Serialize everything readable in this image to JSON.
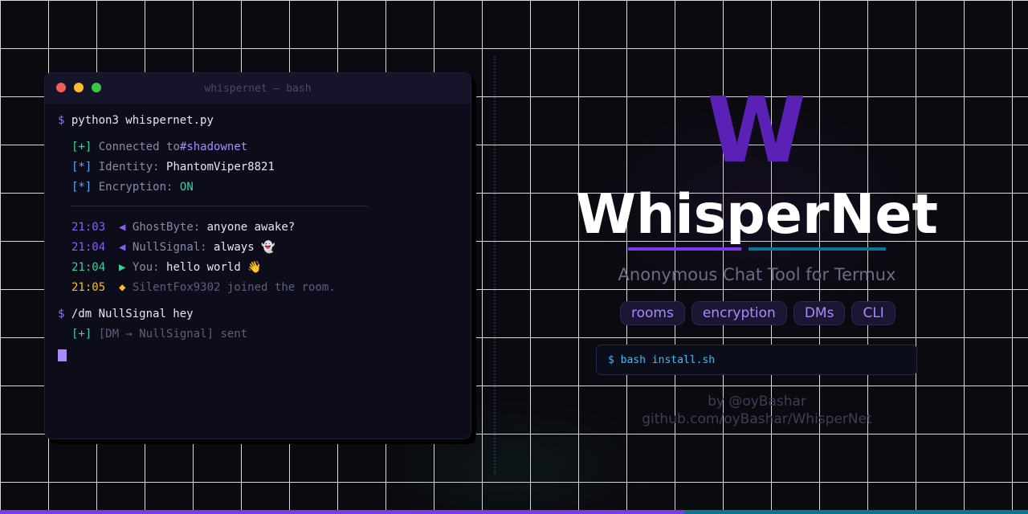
{
  "terminal": {
    "title": "whispernet — bash",
    "prompt": "$",
    "command1": "python3 whispernet.py",
    "status": [
      {
        "bracket": "[+]",
        "label": "Connected to",
        "value": "#shadownet"
      },
      {
        "bracket": "[*]",
        "label": "Identity:",
        "value": "PhantomViper8821"
      },
      {
        "bracket": "[*]",
        "label": "Encryption:",
        "value": "ON"
      }
    ],
    "messages": [
      {
        "time": "21:03",
        "marker": "◀",
        "user": "GhostByte:",
        "text": "anyone awake?"
      },
      {
        "time": "21:04",
        "marker": "◀",
        "user": "NullSignal:",
        "text": "always 👻"
      },
      {
        "time": "21:04",
        "marker": "▶",
        "user": "You:",
        "text": "hello world 👋"
      },
      {
        "time": "21:05",
        "marker": "◆",
        "user": "",
        "text": "SilentFox9302 joined the room."
      }
    ],
    "command2": "/dm NullSignal hey",
    "dm_result": {
      "bracket": "[+]",
      "text": "[DM → NullSignal] sent"
    }
  },
  "hero": {
    "logo_letter": "W",
    "title": "WhisperNet",
    "subtitle": "Anonymous Chat Tool for Termux",
    "tags": [
      "rooms",
      "encryption",
      "DMs",
      "CLI"
    ],
    "install_cmd": "$ bash install.sh",
    "author": "by @oyBashar",
    "repo": "github.com/oyBashar/WhisperNet"
  },
  "colors": {
    "accent_purple": "#7c3aed",
    "accent_teal": "#0e7490",
    "background": "#0b0a10"
  }
}
